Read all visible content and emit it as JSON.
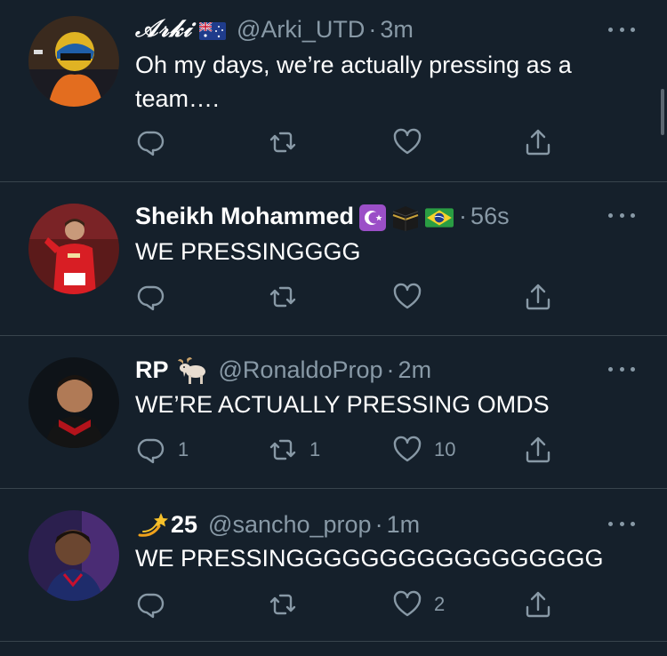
{
  "tweets": [
    {
      "display_name": "𝒜𝓇𝓀𝒾",
      "badges": [
        "australia-flag"
      ],
      "handle": "@Arki_UTD",
      "time": "3m",
      "text": "Oh my days, we’re actually pressing as a team….",
      "replies": "",
      "retweets": "",
      "likes": ""
    },
    {
      "display_name": "Sheikh Mohammed",
      "badges": [
        "star-and-crescent",
        "kaaba",
        "brazil-flag"
      ],
      "handle": "",
      "time": "56s",
      "text": "WE PRESSINGGGG",
      "replies": "",
      "retweets": "",
      "likes": ""
    },
    {
      "display_name": "RP",
      "badges": [
        "goat"
      ],
      "handle": "@RonaldoProp",
      "time": "2m",
      "text": "WE’RE ACTUALLY PRESSING OMDS",
      "replies": "1",
      "retweets": "1",
      "likes": "10"
    },
    {
      "display_name": "25",
      "badges_before": [
        "dizzy"
      ],
      "handle": "@sancho_prop",
      "time": "1m",
      "text": "WE PRESSINGGGGGGGGGGGGGGGGG",
      "replies": "",
      "retweets": "",
      "likes": "2"
    }
  ],
  "separator": "·",
  "colors": {
    "background": "#15202b",
    "divider": "#38444d",
    "muted": "#8899a6",
    "text": "#ffffff"
  },
  "icons": [
    "reply-icon",
    "retweet-icon",
    "like-icon",
    "share-icon",
    "more-icon"
  ]
}
